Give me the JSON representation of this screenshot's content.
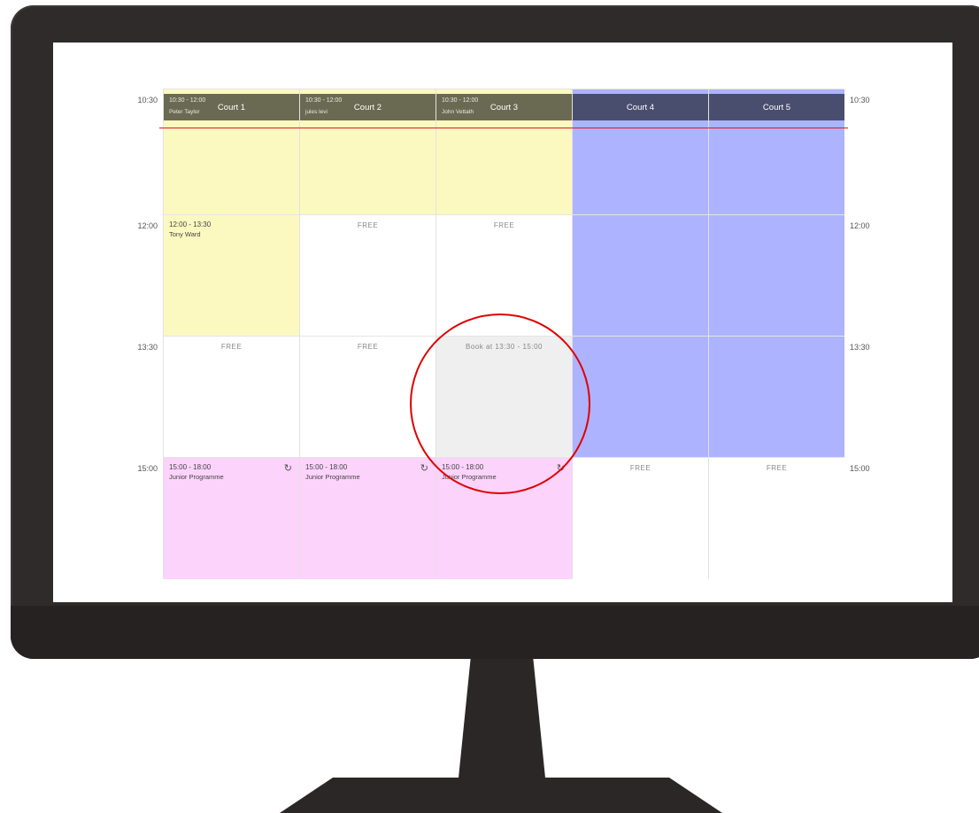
{
  "times": [
    "10:30",
    "12:00",
    "13:30",
    "15:00"
  ],
  "courts": [
    {
      "name": "Court 1",
      "header_time": "10:30 - 12:00",
      "header_who": "Peter Taylor",
      "slots": [
        {
          "type": "yellow",
          "time": "",
          "who": "",
          "free": ""
        },
        {
          "type": "yellow",
          "time": "12:00 - 13:30",
          "who": "Tony Ward",
          "free": ""
        },
        {
          "type": "white",
          "time": "",
          "who": "",
          "free": "FREE"
        },
        {
          "type": "pink",
          "time": "15:00 - 18:00",
          "who": "Junior Programme",
          "free": ""
        }
      ]
    },
    {
      "name": "Court 2",
      "header_time": "10:30 - 12:00",
      "header_who": "jules levi",
      "slots": [
        {
          "type": "yellow",
          "time": "",
          "who": "",
          "free": ""
        },
        {
          "type": "white",
          "time": "",
          "who": "",
          "free": "FREE"
        },
        {
          "type": "white",
          "time": "",
          "who": "",
          "free": "FREE"
        },
        {
          "type": "pink",
          "time": "15:00 - 18:00",
          "who": "Junior Programme",
          "free": ""
        }
      ]
    },
    {
      "name": "Court 3",
      "header_time": "10:30 - 12:00",
      "header_who": "John Vettath",
      "slots": [
        {
          "type": "yellow",
          "time": "",
          "who": "",
          "free": ""
        },
        {
          "type": "white",
          "time": "",
          "who": "",
          "free": "FREE"
        },
        {
          "type": "grey",
          "time": "",
          "who": "",
          "free": "Book at 13:30 - 15:00"
        },
        {
          "type": "pink",
          "time": "15:00 - 18:00",
          "who": "Junior Programme",
          "free": ""
        }
      ]
    },
    {
      "name": "Court 4",
      "header_time": "",
      "header_who": "",
      "slots": [
        {
          "type": "blue",
          "time": "",
          "who": "",
          "free": ""
        },
        {
          "type": "blue",
          "time": "",
          "who": "",
          "free": ""
        },
        {
          "type": "blue",
          "time": "",
          "who": "",
          "free": ""
        },
        {
          "type": "white",
          "time": "",
          "who": "",
          "free": "FREE"
        }
      ]
    },
    {
      "name": "Court 5",
      "header_time": "",
      "header_who": "",
      "slots": [
        {
          "type": "blue",
          "time": "",
          "who": "",
          "free": ""
        },
        {
          "type": "blue",
          "time": "",
          "who": "",
          "free": ""
        },
        {
          "type": "blue",
          "time": "",
          "who": "",
          "free": ""
        },
        {
          "type": "white",
          "time": "",
          "who": "",
          "free": "FREE"
        }
      ]
    }
  ],
  "colors": {
    "booked": "#fbf9c0",
    "programme": "#fbd3fb",
    "blocked": "#adb3ff",
    "selected": "#efefef",
    "now_line": "#e21b1b",
    "highlight_circle": "#e00000"
  }
}
